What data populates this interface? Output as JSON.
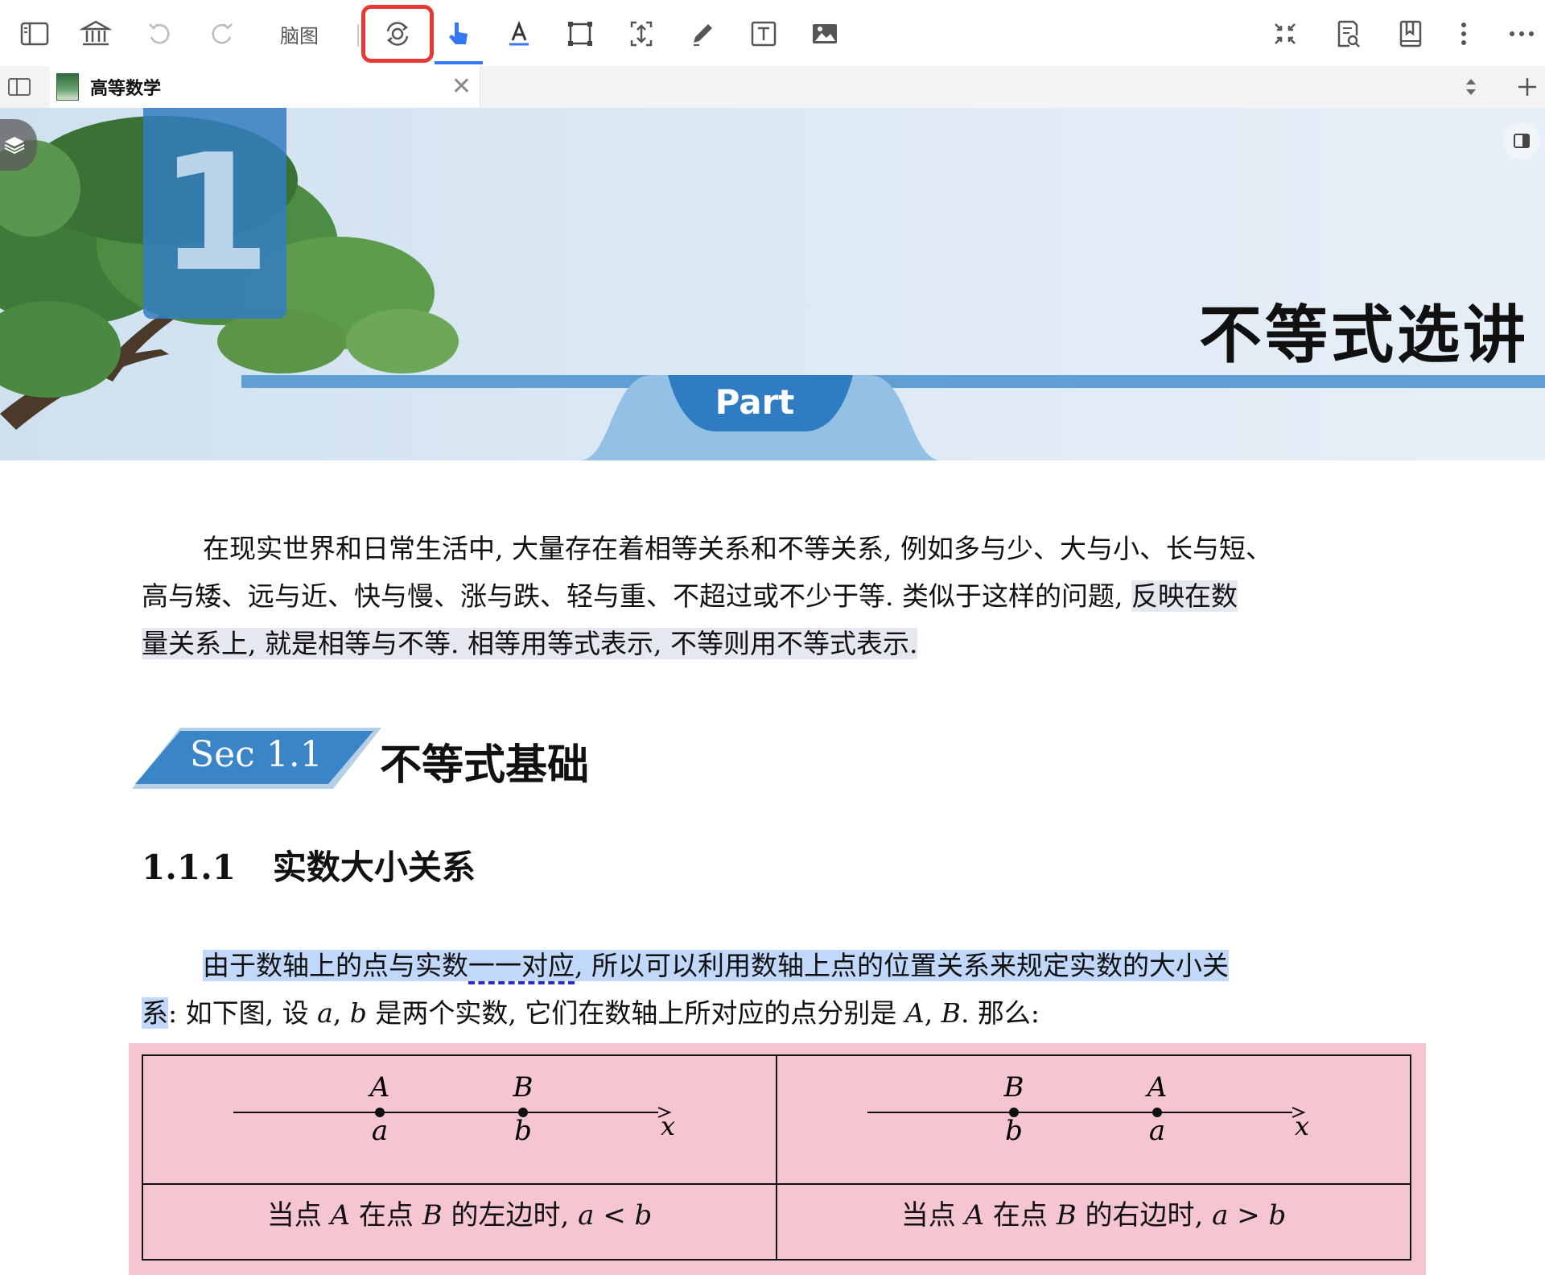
{
  "toolbar": {
    "mindmap_label": "脑图",
    "icons": [
      "sidebar-toggle-icon",
      "library-icon",
      "undo-icon",
      "redo-icon",
      "settings-sync-icon",
      "pointer-icon",
      "text-highlight-icon",
      "area-select-icon",
      "resize-icon",
      "pen-icon",
      "text-box-icon",
      "image-icon",
      "collapse-icon",
      "search-document-icon",
      "bookmark-icon",
      "more-vertical-icon",
      "more-horizontal-icon"
    ]
  },
  "tab": {
    "title": "高等数学"
  },
  "banner": {
    "chapter_number": "1",
    "chapter_title": "不等式选讲",
    "part_label": "Part"
  },
  "intro": {
    "line1": "在现实世界和日常生活中, 大量存在着相等关系和不等关系, 例如多与少、大与小、长与短、",
    "line2a": "高与矮、远与近、快与慢、涨与跌、轻与重、不超过或不少于等. 类似于这样的问题, ",
    "line2b": "反映在数",
    "line3": "量关系上, 就是相等与不等. 相等用等式表示, 不等则用不等式表示."
  },
  "section": {
    "label": "Sec 1.1",
    "title": "不等式基础"
  },
  "subsection": {
    "number": "1.1.1",
    "title": "实数大小关系"
  },
  "para2": {
    "line1a": "由于数轴上的点与实数",
    "line1b": "一一对应",
    "line1c": ", 所以可以利用数轴上点的位置关系来规定实数的大小关",
    "line2a": "系",
    "line2b": ": 如下图, 设 ",
    "var_a": "a",
    "comma": ", ",
    "var_b": "b",
    "line2c": " 是两个实数, 它们在数轴上所对应的点分别是 ",
    "pt_a": "A",
    "comma2": ", ",
    "pt_b": "B",
    "line2d": ". 那么:"
  },
  "figure": {
    "left": {
      "point1_upper": "A",
      "point1_lower": "a",
      "point2_upper": "B",
      "point2_lower": "b",
      "axis_label": "x",
      "caption_pre": "当点 ",
      "caption_A": "A",
      "caption_mid": " 在点 ",
      "caption_B": "B",
      "caption_post": " 的左边时, ",
      "caption_rel": "a < b"
    },
    "right": {
      "point1_upper": "B",
      "point1_lower": "b",
      "point2_upper": "A",
      "point2_lower": "a",
      "axis_label": "x",
      "caption_pre": "当点 ",
      "caption_A": "A",
      "caption_mid": " 在点 ",
      "caption_B": "B",
      "caption_post": " 的右边时, ",
      "caption_rel": "a > b"
    }
  },
  "colors": {
    "accent_blue": "#3478f6",
    "highlight_red": "#e53935",
    "chapter_blue": "#347dc1",
    "figure_pink": "#f5c5d1"
  }
}
